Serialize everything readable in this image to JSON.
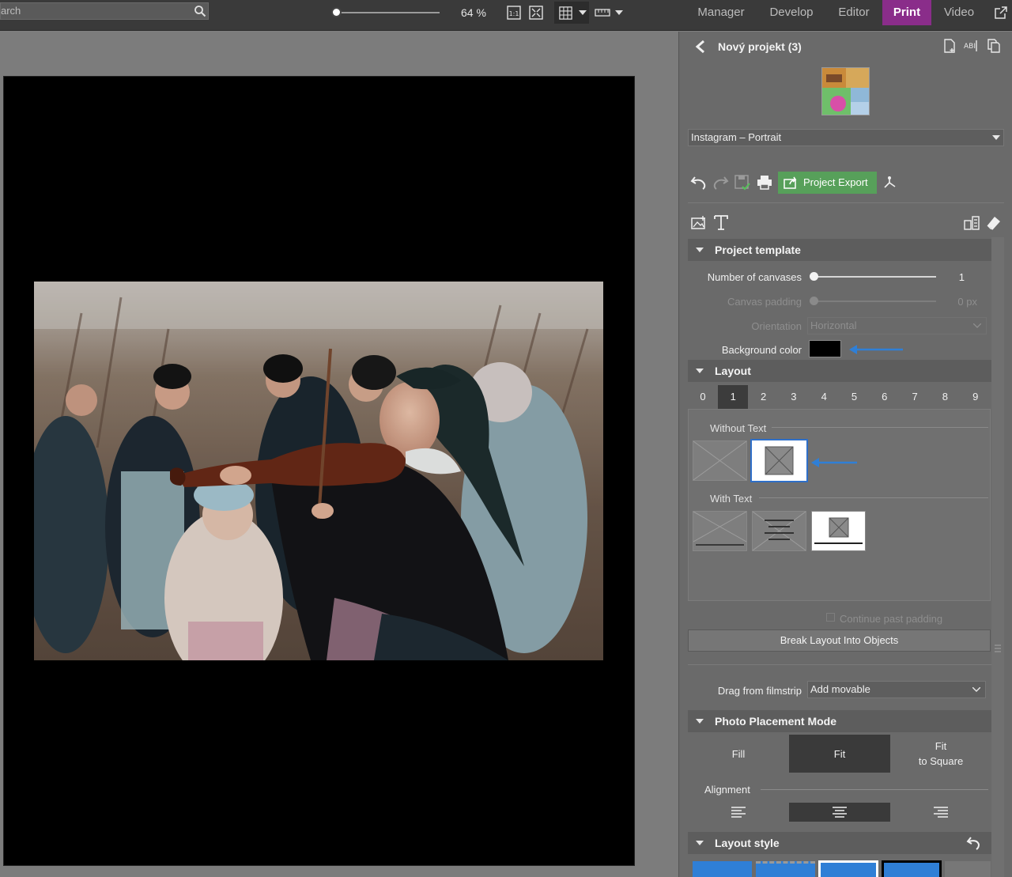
{
  "toolbar": {
    "search_placeholder": "arch",
    "zoom_label": "64 %",
    "zoom_value": 0.02
  },
  "modules": {
    "manager": "Manager",
    "develop": "Develop",
    "editor": "Editor",
    "print": "Print",
    "video": "Video"
  },
  "panel": {
    "title": "Nový projekt (3)",
    "preset": "Instagram – Portrait",
    "export_label": "Project Export",
    "project_template": {
      "header": "Project template",
      "canvases_label": "Number of canvases",
      "canvases_value": "1",
      "padding_label": "Canvas padding",
      "padding_value": "0 px",
      "orientation_label": "Orientation",
      "orientation_value": "Horizontal",
      "bg_label": "Background color",
      "bg_color": "#000000"
    },
    "layout": {
      "header": "Layout",
      "numbers": [
        "0",
        "1",
        "2",
        "3",
        "4",
        "5",
        "6",
        "7",
        "8",
        "9"
      ],
      "selected": "1",
      "without_text": "Without Text",
      "with_text": "With Text",
      "continue_padding": "Continue past padding",
      "break_button": "Break Layout Into Objects"
    },
    "drag": {
      "label": "Drag from filmstrip",
      "value": "Add movable"
    },
    "placement": {
      "header": "Photo Placement Mode",
      "fill": "Fill",
      "fit": "Fit",
      "fit_square_1": "Fit",
      "fit_square_2": "to Square",
      "alignment": "Alignment"
    },
    "layout_style": {
      "header": "Layout style"
    }
  },
  "colors": {
    "accent_print": "#8a2d8a",
    "export_green": "#57a05a",
    "arrow_blue": "#2f7fd6"
  }
}
